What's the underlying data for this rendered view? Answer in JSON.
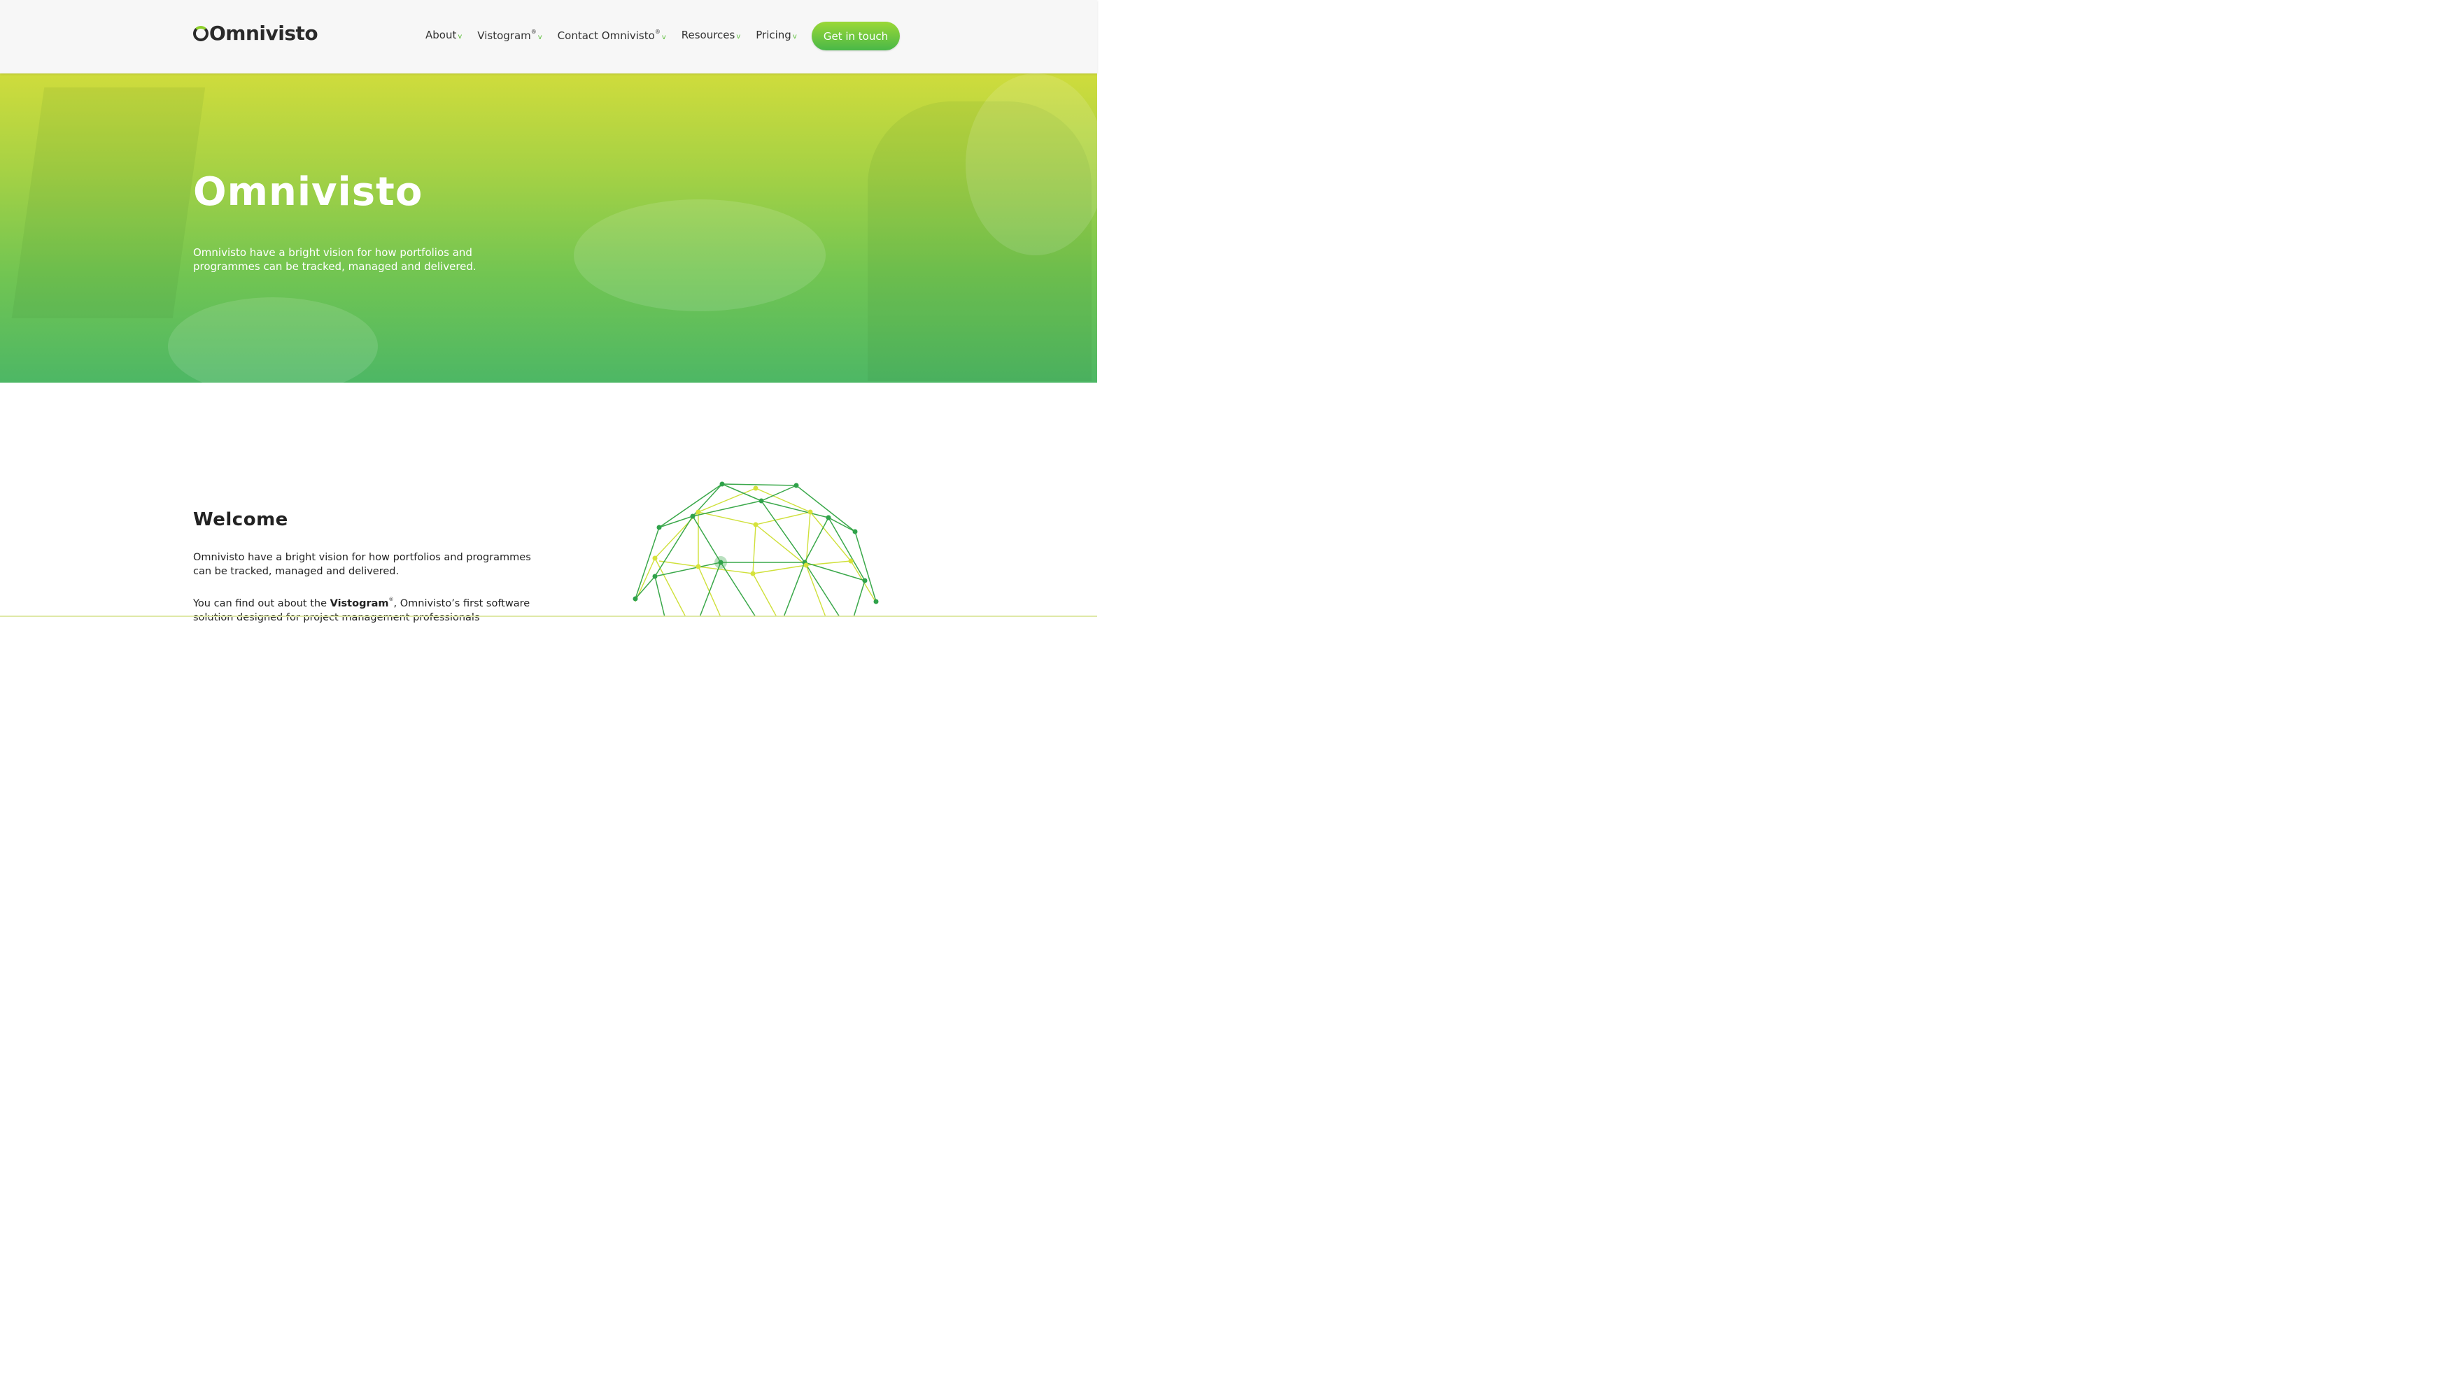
{
  "header": {
    "logo_text": "Omnivisto",
    "nav": [
      {
        "label": "About",
        "sup": ""
      },
      {
        "label": "Vistogram",
        "sup": "®"
      },
      {
        "label": "Contact Omnivisto",
        "sup": "®"
      },
      {
        "label": "Resources",
        "sup": ""
      },
      {
        "label": "Pricing",
        "sup": ""
      }
    ],
    "caret": "v",
    "cta_label": "Get in touch"
  },
  "hero": {
    "title": "Omnivisto",
    "text": "Omnivisto have a bright vision for how portfolios and programmes can be tracked, managed and delivered."
  },
  "welcome": {
    "title": "Welcome",
    "p1": "Omnivisto have a bright vision for how portfolios and programmes can be tracked, managed and delivered.",
    "p2_before": "You can find out about the ",
    "p2_bold": "Vistogram",
    "p2_sup": "®",
    "p2_after": ", Omnivisto’s first software solution designed for project management professionals"
  },
  "colors": {
    "accent_green": "#49b848",
    "accent_lime": "#9bd836",
    "sphere_dark": "#3aa84a",
    "sphere_light": "#cfe03a"
  }
}
